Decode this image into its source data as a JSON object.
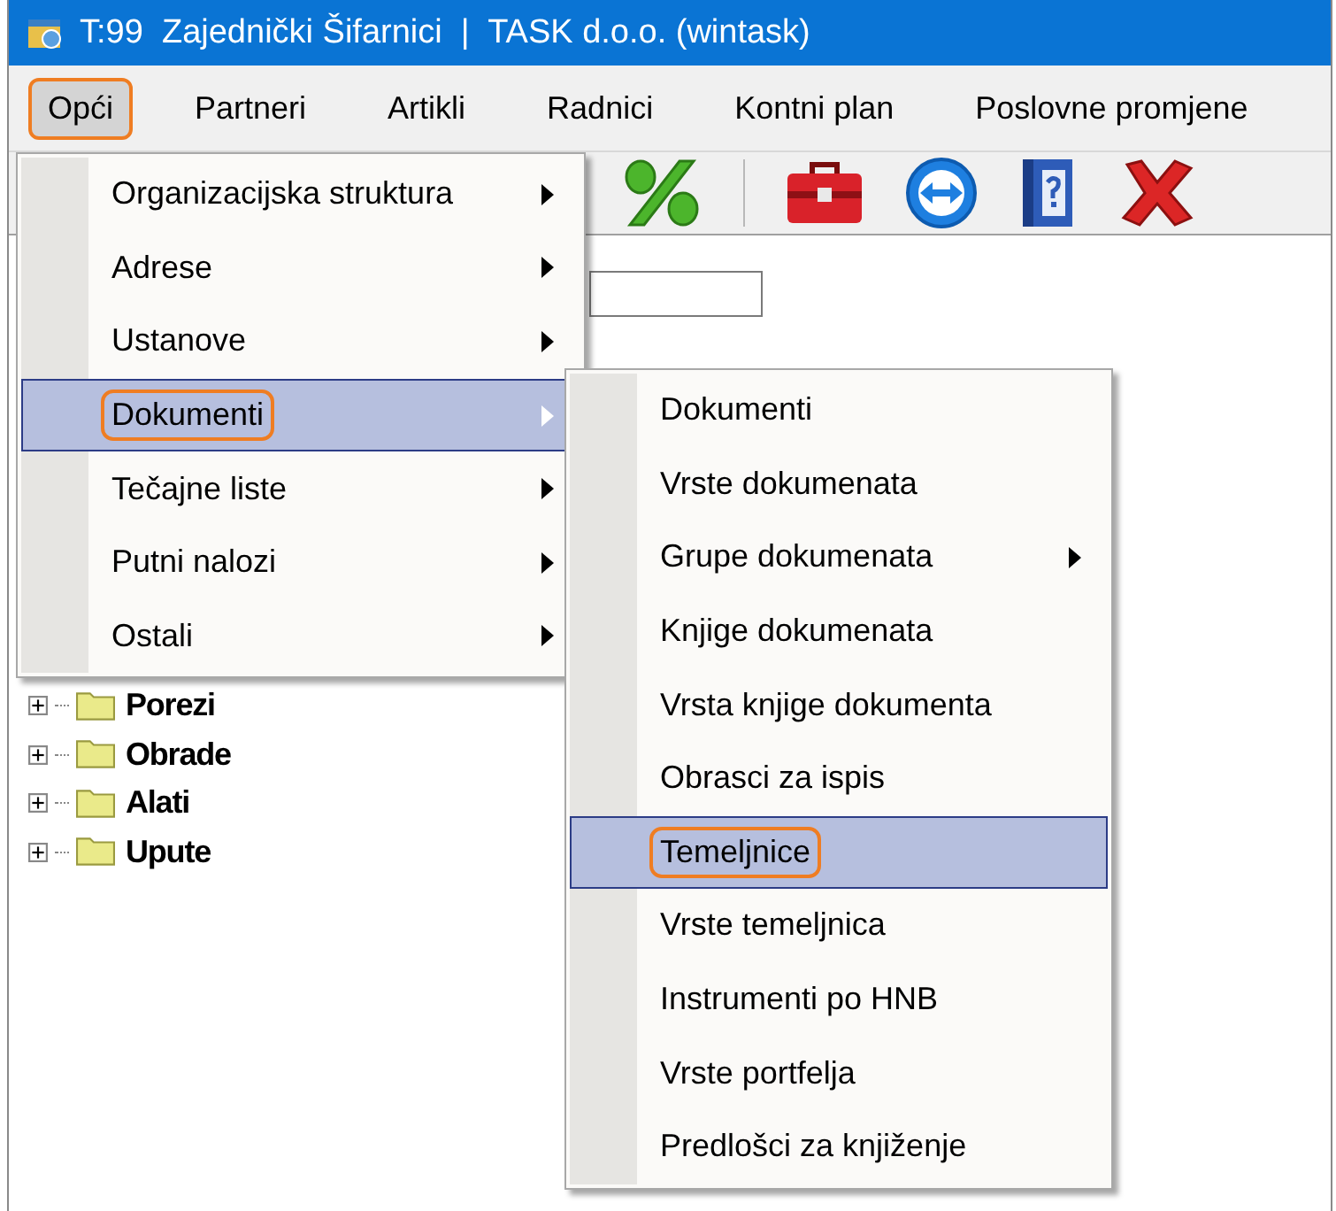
{
  "window": {
    "title": "T:99  Zajednički Šifarnici  |  TASK d.o.o. (wintask)"
  },
  "menubar": {
    "items": [
      {
        "label": "Opći",
        "selected": true,
        "annotated": true
      },
      {
        "label": "Partneri",
        "selected": false,
        "annotated": false
      },
      {
        "label": "Artikli",
        "selected": false,
        "annotated": false
      },
      {
        "label": "Radnici",
        "selected": false,
        "annotated": false
      },
      {
        "label": "Kontni plan",
        "selected": false,
        "annotated": false
      },
      {
        "label": "Poslovne promjene",
        "selected": false,
        "annotated": false
      }
    ]
  },
  "menu": {
    "items": [
      {
        "label": "Organizacijska struktura",
        "submenu": true,
        "selected": false,
        "annotated": false
      },
      {
        "label": "Adrese",
        "submenu": true,
        "selected": false,
        "annotated": false
      },
      {
        "label": "Ustanove",
        "submenu": true,
        "selected": false,
        "annotated": false
      },
      {
        "label": "Dokumenti",
        "submenu": true,
        "selected": true,
        "annotated": true
      },
      {
        "label": "Tečajne liste",
        "submenu": true,
        "selected": false,
        "annotated": false
      },
      {
        "label": "Putni nalozi",
        "submenu": true,
        "selected": false,
        "annotated": false
      },
      {
        "label": "Ostali",
        "submenu": true,
        "selected": false,
        "annotated": false
      }
    ]
  },
  "submenu": {
    "items": [
      {
        "label": "Dokumenti",
        "submenu": false,
        "selected": false,
        "annotated": false
      },
      {
        "label": "Vrste dokumenata",
        "submenu": false,
        "selected": false,
        "annotated": false
      },
      {
        "label": "Grupe dokumenata",
        "submenu": true,
        "selected": false,
        "annotated": false
      },
      {
        "label": "Knjige dokumenata",
        "submenu": false,
        "selected": false,
        "annotated": false
      },
      {
        "label": "Vrsta knjige dokumenta",
        "submenu": false,
        "selected": false,
        "annotated": false
      },
      {
        "label": "Obrasci za ispis",
        "submenu": false,
        "selected": false,
        "annotated": false
      },
      {
        "label": "Temeljnice",
        "submenu": false,
        "selected": true,
        "annotated": true
      },
      {
        "label": "Vrste temeljnica",
        "submenu": false,
        "selected": false,
        "annotated": false
      },
      {
        "label": "Instrumenti po HNB",
        "submenu": false,
        "selected": false,
        "annotated": false
      },
      {
        "label": "Vrste portfelja",
        "submenu": false,
        "selected": false,
        "annotated": false
      },
      {
        "label": "Predlošci za knjiženje",
        "submenu": false,
        "selected": false,
        "annotated": false
      }
    ]
  },
  "tree": {
    "items": [
      {
        "label": "Porezi",
        "expanded": false
      },
      {
        "label": "Obrade",
        "expanded": false
      },
      {
        "label": "Alati",
        "expanded": false
      },
      {
        "label": "Upute",
        "expanded": false
      }
    ]
  }
}
